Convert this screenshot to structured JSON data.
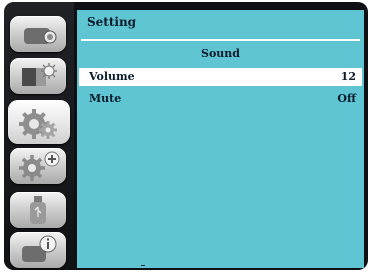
{
  "menu": {
    "title": "Setting",
    "section": "Sound",
    "items": [
      {
        "label": "Volume",
        "value": "12",
        "selected": true
      },
      {
        "label": "Mute",
        "value": "Off",
        "selected": false
      }
    ]
  },
  "sidebar": {
    "icons": [
      {
        "name": "display-icon",
        "active": false
      },
      {
        "name": "picture-adjust-icon",
        "active": false
      },
      {
        "name": "setting-gear-icon",
        "active": true
      },
      {
        "name": "expanded-setting-icon",
        "active": false
      },
      {
        "name": "usb-memory-icon",
        "active": false
      },
      {
        "name": "info-icon",
        "active": false
      }
    ]
  },
  "colors": {
    "panel": "#5fc5d3",
    "selected_row": "#ffffff",
    "text": "#0b1b2a"
  }
}
